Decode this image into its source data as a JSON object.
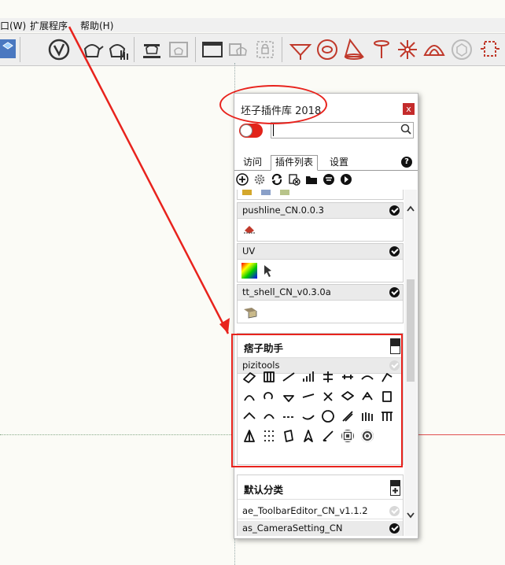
{
  "menubar": {
    "partial": "口(W)",
    "extensions": "扩展程序",
    "help": "帮助(H)"
  },
  "panel": {
    "title": "坯子插件库 2018",
    "close": "x",
    "search_value": "",
    "tabs": [
      {
        "label": "访问",
        "active": false
      },
      {
        "label": "插件列表",
        "active": true
      },
      {
        "label": "设置",
        "active": false
      }
    ],
    "help": "?",
    "plugins": [
      {
        "name": "pushline_CN.0.0.3",
        "enabled": true
      },
      {
        "name": "UV",
        "enabled": true
      },
      {
        "name": "tt_shell_CN_v0.3.0a",
        "enabled": true
      }
    ],
    "category1": {
      "title": "痞子助手",
      "plugin": {
        "name": "pizitools",
        "enabled": false
      }
    },
    "category2": {
      "title": "默认分类",
      "plugins": [
        {
          "name": "ae_ToolbarEditor_CN_v1.1.2",
          "enabled": false
        },
        {
          "name": "as_CameraSetting_CN",
          "enabled": true
        }
      ]
    }
  },
  "colors": {
    "annotation": "#e8231d",
    "toggle": "#e2231a",
    "toolbar_icon": "#c0392b",
    "red_axis": "#e05050"
  }
}
